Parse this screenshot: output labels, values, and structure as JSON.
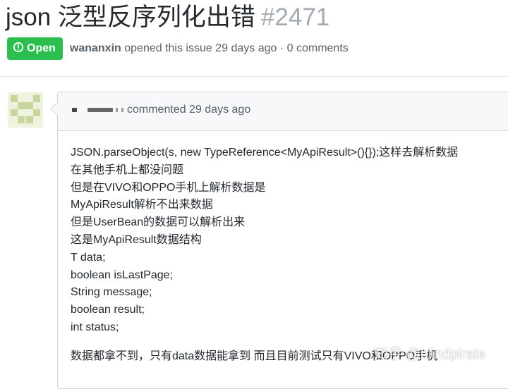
{
  "issue": {
    "title": "json 泛型反序列化出错",
    "number": "#2471"
  },
  "meta": {
    "state": "Open",
    "author": "wananxin",
    "opened_text": "opened this issue 29 days ago · 0 comments"
  },
  "comment": {
    "header_text": "commented 29 days ago",
    "body_lines": [
      "JSON.parseObject(s, new TypeReference<MyApiResult>(){});这样去解析数据",
      "在其他手机上都没问题",
      "但是在VIVO和OPPO手机上解析数据是",
      "MyApiResult解析不出来数据",
      "但是UserBean的数据可以解析出来",
      "这是MyApiResult数据结构",
      "T data;",
      "boolean isLastPage;",
      "String message;",
      "boolean result;",
      "int status;"
    ],
    "last_paragraph": "数据都拿不到，只有data数据能拿到 而且目前测试只有VIVO和OPPO手机"
  },
  "watermark": "知乎 @blindpirate",
  "colors": {
    "open_badge": "#2cbe4e",
    "issue_number": "#a3aab1",
    "header_bg": "#f6f8fa",
    "border": "#d1d5da"
  },
  "icons": [
    "issue-opened-icon",
    "identicon-avatar"
  ]
}
